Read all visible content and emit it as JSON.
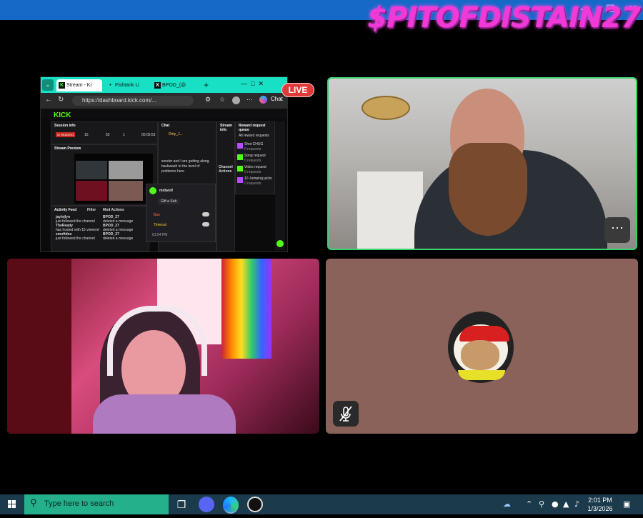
{
  "overlay": {
    "brand_text": "$PITOFDISTAIN27",
    "live_badge": "LIVE"
  },
  "browser": {
    "tabs": [
      {
        "label": "Stream - Ki"
      },
      {
        "label": "Fishtank Li"
      },
      {
        "label": "BPOD_(@"
      }
    ],
    "url": "https://dashboard.kick.com/...",
    "chat_button": "Chat",
    "kick": {
      "logo": "KICK",
      "session_info": "Session info",
      "stream_preview": "Stream Preview",
      "chat": "Chat",
      "stream_info": "Stream info",
      "reward_queue": "Reward request queue",
      "all_reward_requests": "All reward requests",
      "rewards": [
        {
          "name": "Shot CHUG",
          "count": "0 requests",
          "color": "#b84dff"
        },
        {
          "name": "Song request",
          "count": "0 requests",
          "color": "#53fc18"
        },
        {
          "name": "Video request",
          "count": "0 requests",
          "color": "#53fc18"
        },
        {
          "name": "10 Jumping jacks",
          "count": "0 requests",
          "color": "#b84dff"
        }
      ],
      "activity_feed": "Activity Feed",
      "filter": "Filter",
      "mod_actions": "Mod Actions",
      "activity": [
        {
          "user": "jaylnjlyn",
          "text": "just followed the channel"
        },
        {
          "user": "TheReady",
          "text": "has hosted with 15 viewers!"
        },
        {
          "user": "smoftdoe",
          "text": "just followed the channel"
        }
      ],
      "mod": [
        {
          "user": "BPOD_27",
          "text": "deleted a message"
        },
        {
          "user": "BPOD_27",
          "text": "deleted a message"
        },
        {
          "user": "BPOD_27",
          "text": "deleted a message"
        }
      ],
      "chat_msg": "sender and I are getting along. backwash to the level of problems here",
      "pinned_user": "Dirty_J...",
      "gift_sub": "Gift a Sub",
      "mod_user": "midwolf",
      "ban_label": "Ban",
      "timeout_label": "Timeout",
      "chat_time": "01:54 PM",
      "stats": [
        "15",
        "52",
        "1",
        "00:05:53"
      ],
      "actions": "Channel Actions",
      "status_badge": "ID READING"
    }
  },
  "taskbar": {
    "search_placeholder": "Type here to search",
    "time": "2:01 PM",
    "date": "1/3/2026"
  },
  "colors": {
    "accent_green": "#3bd16f",
    "kick_green": "#53fc18",
    "live_red": "#e03a3a",
    "brand_pink": "#f03ad8",
    "taskbar": "#1b3a4b",
    "search": "#23b08a"
  }
}
